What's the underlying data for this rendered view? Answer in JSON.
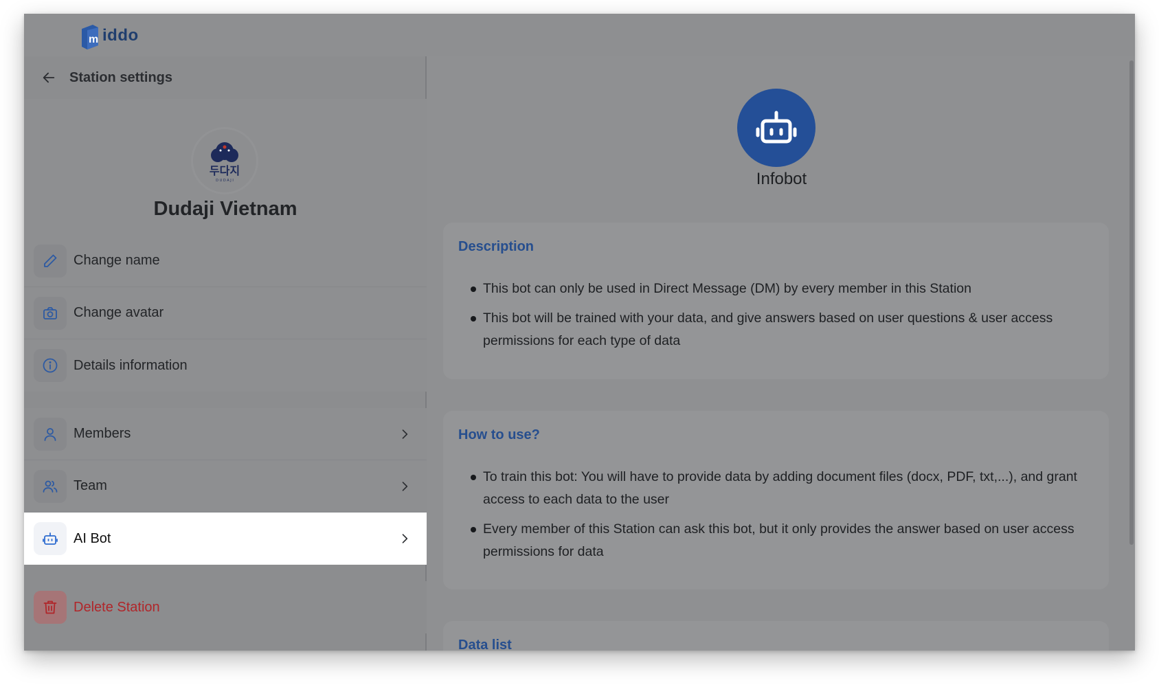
{
  "app": {
    "logo_text": "iddo",
    "logo_letter": "m"
  },
  "left_panel": {
    "title": "Station settings",
    "station_name": "Dudaji Vietnam",
    "avatar_text": "두다지",
    "menu": [
      {
        "label": "Change name",
        "icon": "pencil-icon"
      },
      {
        "label": "Change avatar",
        "icon": "camera-icon"
      },
      {
        "label": "Details information",
        "icon": "info-icon"
      },
      {
        "label": "Members",
        "icon": "user-icon"
      },
      {
        "label": "Team",
        "icon": "users-icon"
      },
      {
        "label": "AI Bot",
        "icon": "bot-icon",
        "active": true
      },
      {
        "label": "Delete Station",
        "icon": "trash-icon"
      }
    ]
  },
  "right_panel": {
    "bot_name": "Infobot",
    "sections": [
      {
        "title": "Description",
        "bullets": [
          "This bot can only be used in Direct Message (DM) by every member in this Station",
          "This bot will be trained with your data, and give answers based on user questions & user access permissions for each type of data"
        ]
      },
      {
        "title": "How to use?",
        "bullets": [
          "To train this bot: You will have to provide data by adding document files (docx, PDF, txt,...), and grant access to each data to the user",
          "Every member of this Station can ask this bot, but it only provides the answer based on user access permissions for data"
        ]
      },
      {
        "title": "Data list",
        "bullets": []
      }
    ]
  },
  "colors": {
    "accent": "#244f97",
    "danger": "#b0262a",
    "overlay": "#8f9092"
  }
}
